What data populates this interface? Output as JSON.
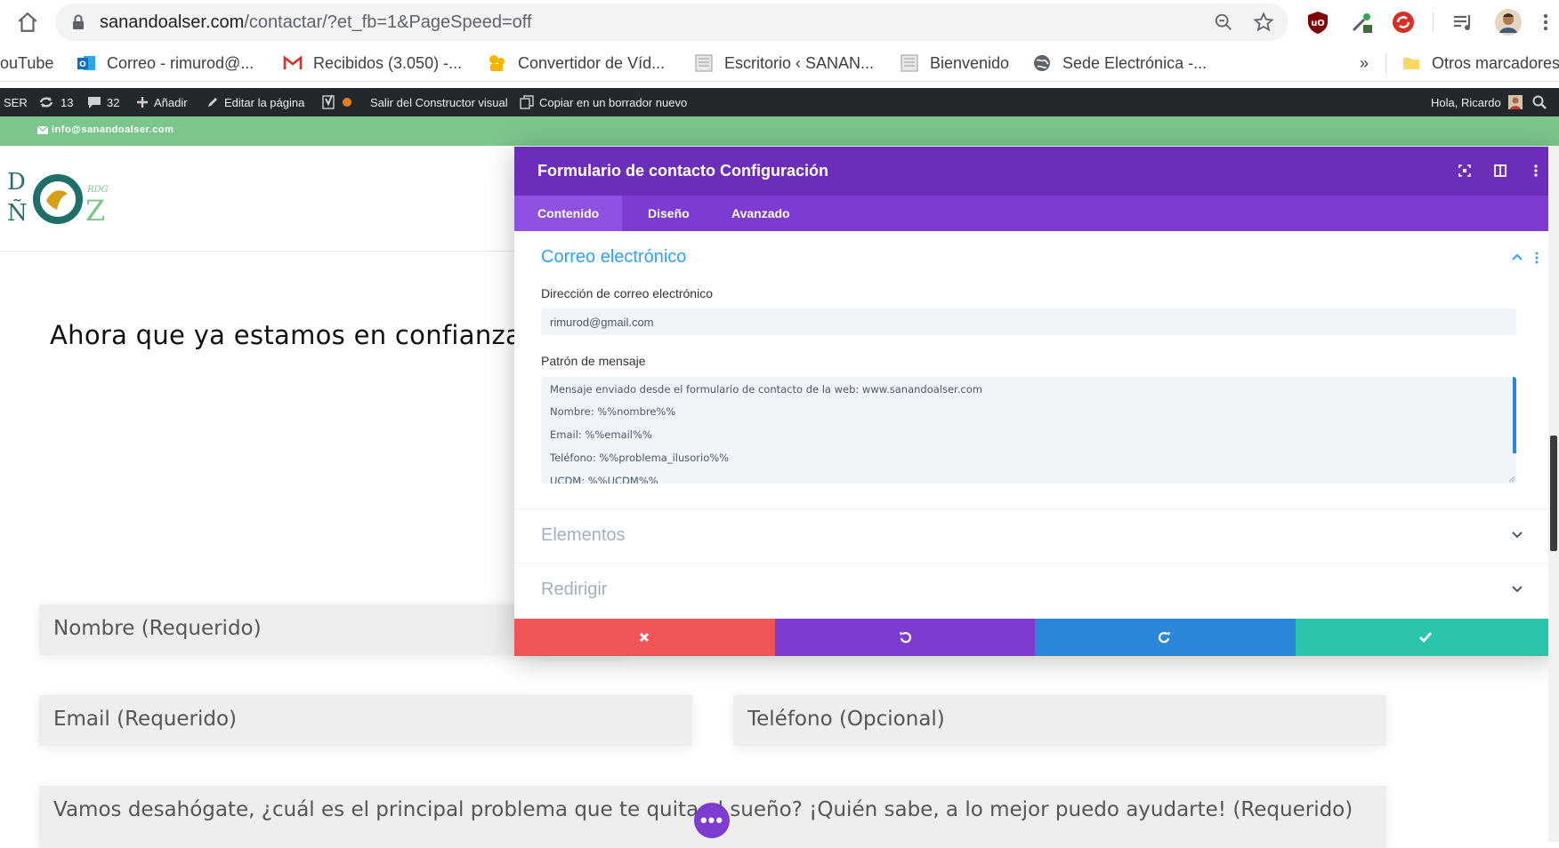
{
  "browser": {
    "url_main": "sanandoalser.com",
    "url_rest": "/contactar/?et_fb=1&PageSpeed=off",
    "colors": {
      "ublock": "#800000",
      "sync": "#d93025"
    }
  },
  "bookmarks": {
    "items": [
      {
        "label": "ouTube",
        "icon": "youtube-icon"
      },
      {
        "label": "Correo - rimurod@...",
        "icon": "outlook-icon"
      },
      {
        "label": "Recibidos (3.050) -...",
        "icon": "gmail-icon"
      },
      {
        "label": "Convertidor de Víd...",
        "icon": "converter-icon"
      },
      {
        "label": "Escritorio ‹ SANAN...",
        "icon": "page-icon"
      },
      {
        "label": "Bienvenido",
        "icon": "page-icon"
      },
      {
        "label": "Sede Electrónica -...",
        "icon": "globe-icon"
      }
    ],
    "overflow": "»",
    "other": "Otros marcadores"
  },
  "wp_admin": {
    "site": "SER",
    "updates": "13",
    "comments": "32",
    "add": "Añadir",
    "edit": "Editar la página",
    "exit_builder": "Salir del Constructor visual",
    "copy_draft": "Copiar en un borrador nuevo",
    "greeting": "Hola, Ricardo"
  },
  "topbar": {
    "email": "info@sanandoalser.com"
  },
  "logo": {
    "letters_left": "D",
    "letters_left2": "Ñ",
    "letter_o": "O",
    "letter_z": "Z",
    "rdg": "RDG"
  },
  "page": {
    "hero": "Ahora que ya estamos en confianza",
    "fields": {
      "name": "Nombre (Requerido)",
      "email": "Email (Requerido)",
      "phone": "Teléfono (Opcional)",
      "message": "Vamos desahógate, ¿cuál es el principal problema que te quita el sueño? ¡Quién sabe, a lo mejor puedo ayudarte! (Requerido)"
    },
    "more_button": "•••"
  },
  "modal": {
    "title": "Formulario de contacto Configuración",
    "tabs": [
      "Contenido",
      "Diseño",
      "Avanzado"
    ],
    "active_tab": 0,
    "section_open": "Correo electrónico",
    "email_label": "Dirección de correo electrónico",
    "email_value": "rimurod@gmail.com",
    "pattern_label": "Patrón de mensaje",
    "pattern_lines": [
      "Mensaje enviado desde el formulario de contacto de la web: www.sanandoalser.com",
      "Nombre: %%nombre%%",
      "Email: %%email%%",
      "Teléfono: %%problema_ilusorio%%",
      "UCDM: %%UCDM%%"
    ],
    "sections_collapsed": [
      "Elementos",
      "Redirigir"
    ],
    "footer_colors": {
      "cancel": "#ef5555",
      "undo": "#7e3bd0",
      "redo": "#2b87da",
      "save": "#29c4a9"
    },
    "header_color": "#6c2eb9",
    "tabs_color": "#7d3bd1",
    "accent": "#2ea3f2"
  }
}
